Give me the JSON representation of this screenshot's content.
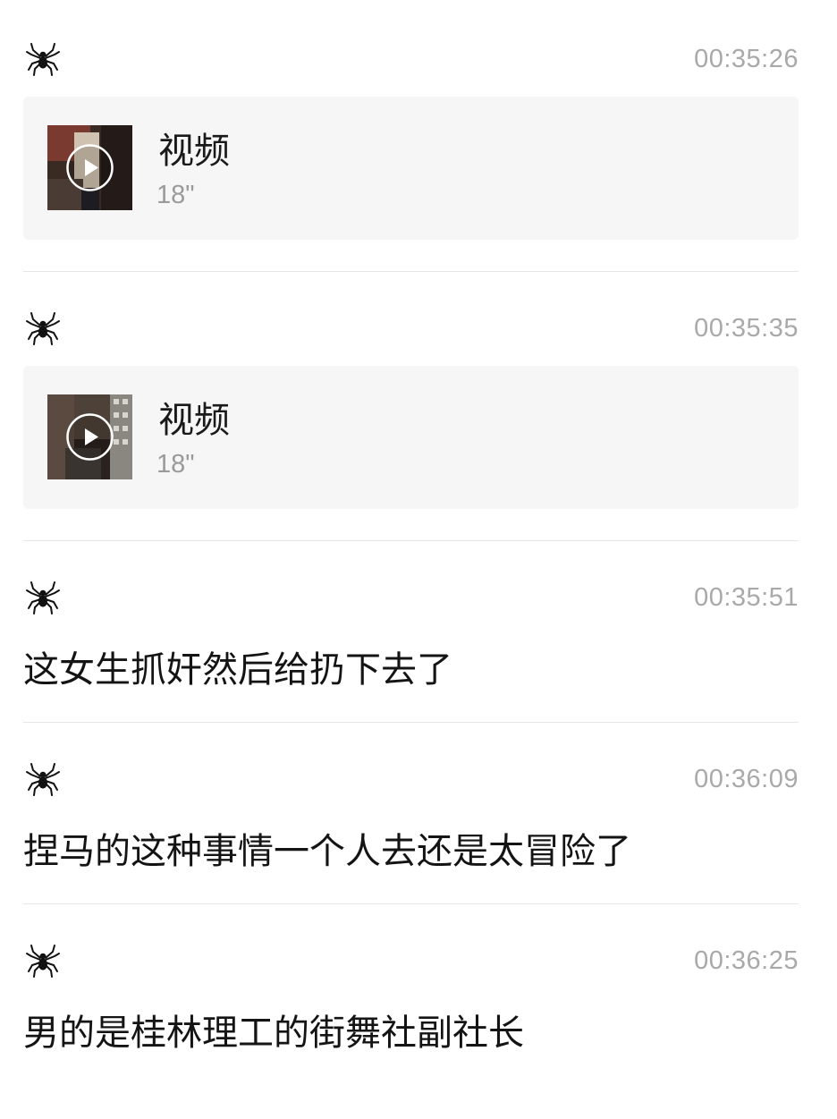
{
  "messages": [
    {
      "avatar_icon": "spider-icon",
      "time": "00:35:26",
      "type": "video",
      "video": {
        "title": "视频",
        "duration": "18\"",
        "play_icon": "play-icon"
      }
    },
    {
      "avatar_icon": "spider-icon",
      "time": "00:35:35",
      "type": "video",
      "video": {
        "title": "视频",
        "duration": "18\"",
        "play_icon": "play-icon"
      }
    },
    {
      "avatar_icon": "spider-icon",
      "time": "00:35:51",
      "type": "text",
      "text": "这女生抓奸然后给扔下去了"
    },
    {
      "avatar_icon": "spider-icon",
      "time": "00:36:09",
      "type": "text",
      "text": "捏马的这种事情一个人去还是太冒险了"
    },
    {
      "avatar_icon": "spider-icon",
      "time": "00:36:25",
      "type": "text",
      "text": "男的是桂林理工的街舞社副社长"
    }
  ],
  "colors": {
    "timestamp": "#a9a9a9",
    "card_bg": "#f6f6f6",
    "divider": "#e6e6e6",
    "text": "#141414"
  }
}
